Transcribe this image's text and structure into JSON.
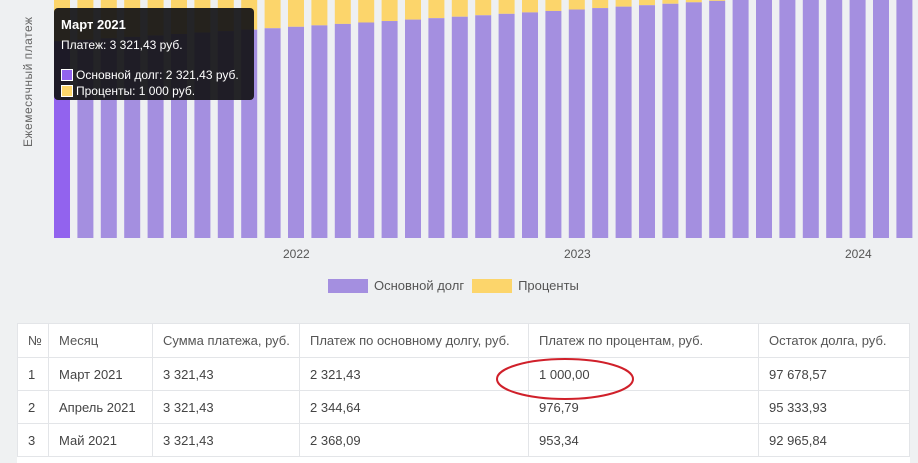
{
  "chart_data": {
    "type": "bar",
    "stacked": true,
    "ylabel": "Ежемесячный платеж",
    "x_tick_labels": [
      "2022",
      "2023",
      "2024"
    ],
    "series": [
      {
        "name": "Основной долг",
        "color": "#a48fe0"
      },
      {
        "name": "Проценты",
        "color": "#fcd56b"
      }
    ],
    "visible_bar_shares_principal": [
      0.7,
      0.71,
      0.72,
      0.73,
      0.74,
      0.75,
      0.76,
      0.77,
      0.78,
      0.79,
      0.8,
      0.81,
      0.82,
      0.83,
      0.84,
      0.85,
      0.86,
      0.87,
      0.88,
      0.89,
      0.9,
      0.91,
      0.92,
      0.93,
      0.94,
      0.95,
      0.96,
      0.97,
      0.98,
      0.99,
      1,
      1,
      1,
      1,
      1,
      1,
      1
    ],
    "legend_position": "bottom"
  },
  "tooltip": {
    "title": "Март 2021",
    "total": "Платеж: 3 321,43 руб.",
    "principal": "Основной долг: 2 321,43 руб.",
    "interest": "Проценты: 1 000 руб."
  },
  "legend": {
    "principal": "Основной долг",
    "interest": "Проценты"
  },
  "table": {
    "headers": [
      "№",
      "Месяц",
      "Сумма платежа, руб.",
      "Платеж по основному долгу, руб.",
      "Платеж по процентам, руб.",
      "Остаток долга, руб."
    ],
    "rows": [
      [
        "1",
        "Март 2021",
        "3 321,43",
        "2 321,43",
        "1 000,00",
        "97 678,57"
      ],
      [
        "2",
        "Апрель 2021",
        "3 321,43",
        "2 344,64",
        "976,79",
        "95 333,93"
      ],
      [
        "3",
        "Май 2021",
        "3 321,43",
        "2 368,09",
        "953,34",
        "92 965,84"
      ]
    ]
  },
  "colors": {
    "principal": "#a48fe0",
    "principal_highlight": "#9263ee",
    "interest": "#fcd56b",
    "annotation": "#d0202a"
  }
}
